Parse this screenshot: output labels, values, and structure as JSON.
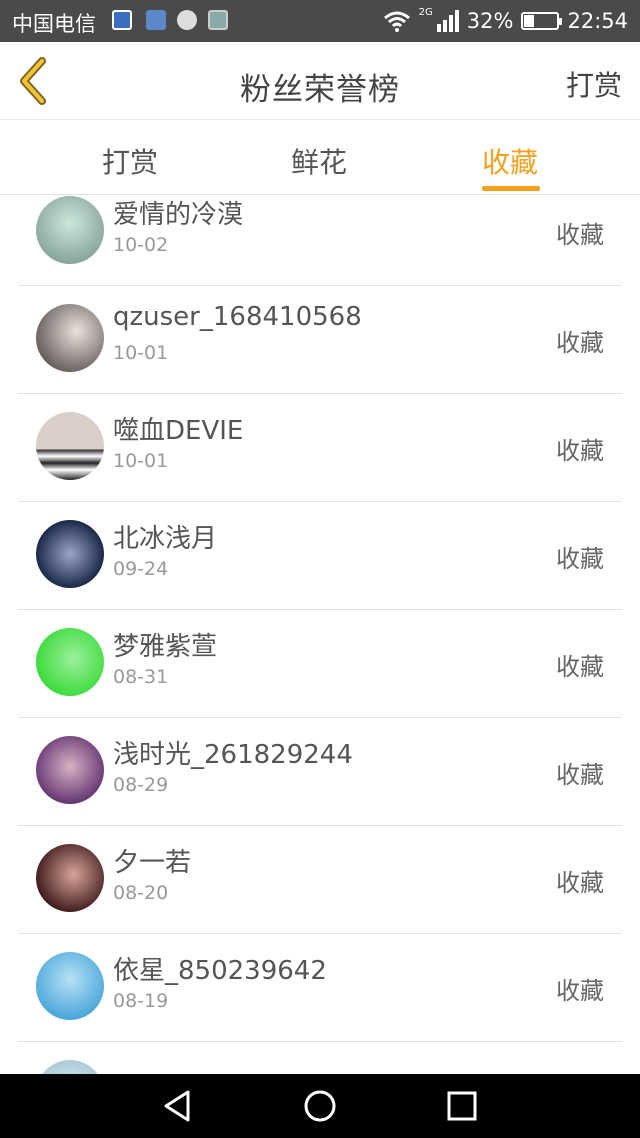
{
  "status_bar": {
    "carrier": "中国电信",
    "network": "2G",
    "battery_percent": "32%",
    "battery_level": 0.32,
    "time": "22:54"
  },
  "header": {
    "back_icon": "chevron-left-icon",
    "title": "粉丝荣誉榜",
    "action": "打赏",
    "accent_color": "#f5a11c"
  },
  "tabs": [
    {
      "label": "打赏",
      "active": false
    },
    {
      "label": "鲜花",
      "active": false
    },
    {
      "label": "收藏",
      "active": true
    }
  ],
  "list": {
    "items": [
      {
        "username": "爱情的冷漠",
        "date": "10-02",
        "action": "收藏",
        "avatar_colors": [
          "#cfe7dc",
          "#6f8f85"
        ]
      },
      {
        "username": "qzuser_168410568",
        "date": "10-01",
        "action": "收藏",
        "avatar_colors": [
          "#e8e2dc",
          "#3a3030"
        ]
      },
      {
        "username": "噬血DEVIE",
        "date": "10-01",
        "action": "收藏",
        "avatar_colors": [
          "#d9cfc8",
          "#222222"
        ]
      },
      {
        "username": "北冰浅月",
        "date": "09-24",
        "action": "收藏",
        "avatar_colors": [
          "#1c2a4a",
          "#9aa6c8"
        ]
      },
      {
        "username": "梦雅紫萱",
        "date": "08-31",
        "action": "收藏",
        "avatar_colors": [
          "#3fdc3f",
          "#9cf09c"
        ]
      },
      {
        "username": "浅时光_261829244",
        "date": "08-29",
        "action": "收藏",
        "avatar_colors": [
          "#d9b2c4",
          "#5a2b6b"
        ]
      },
      {
        "username": "夕一若",
        "date": "08-20",
        "action": "收藏",
        "avatar_colors": [
          "#3a1616",
          "#d9a59a"
        ]
      },
      {
        "username": "依星_850239642",
        "date": "08-19",
        "action": "收藏",
        "avatar_colors": [
          "#4aa6d9",
          "#b6e2f5"
        ]
      },
      {
        "username": "",
        "date": "",
        "action": "",
        "avatar_colors": [
          "#a9c9d6",
          "#e2eef2"
        ]
      }
    ]
  },
  "nav_bar": {
    "buttons": [
      "back-triangle-icon",
      "home-circle-icon",
      "recents-square-icon"
    ]
  }
}
